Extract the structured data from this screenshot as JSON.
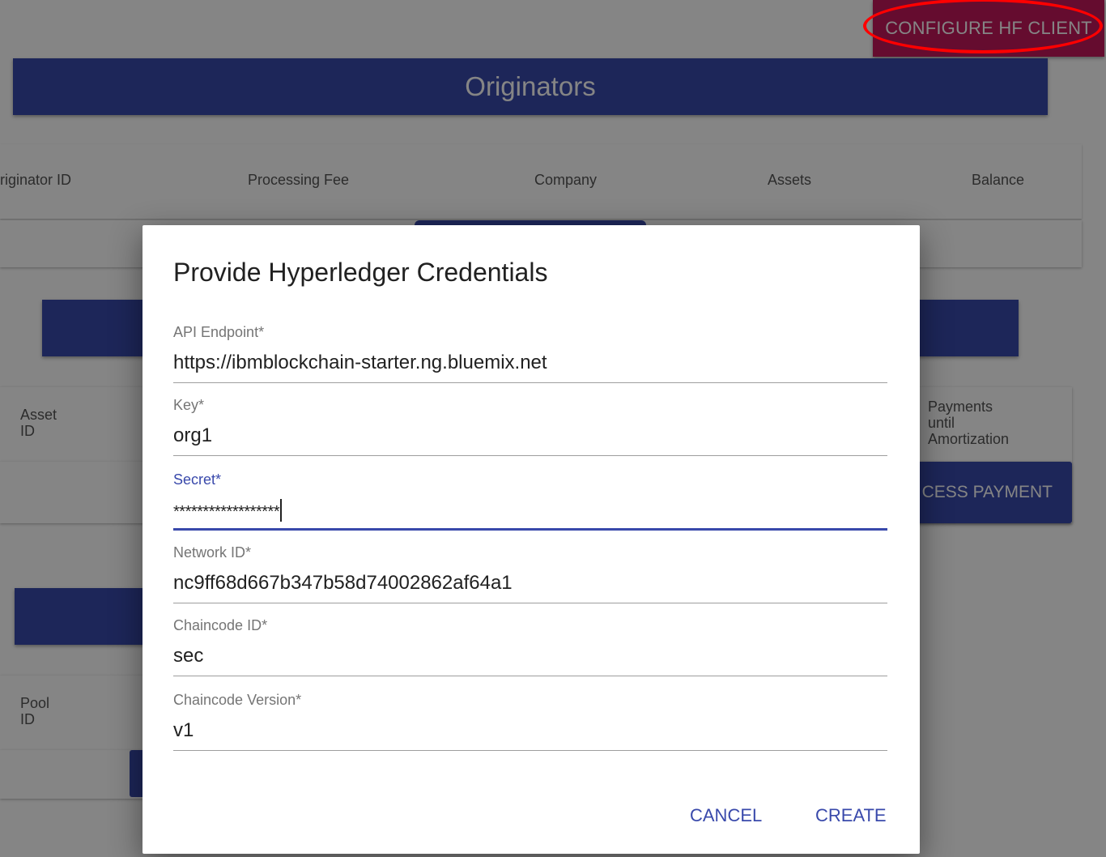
{
  "header": {
    "configure_button": "CONFIGURE HF CLIENT",
    "page_title": "Originators"
  },
  "table": {
    "columns": [
      "riginator ID",
      "Processing Fee",
      "Company",
      "Assets",
      "Balance"
    ]
  },
  "asset_section": {
    "asset_label": "Asset\nID",
    "payments_label": "Payments\nuntil\nAmortization",
    "process_button": "CESS PAYMENT"
  },
  "pool_section": {
    "pool_label": "Pool\nID"
  },
  "dialog": {
    "title": "Provide Hyperledger Credentials",
    "fields": [
      {
        "label": "API Endpoint",
        "required_mark": "*",
        "value": "https://ibmblockchain-starter.ng.bluemix.net"
      },
      {
        "label": "Key",
        "required_mark": "*",
        "value": "org1"
      },
      {
        "label": "Secret",
        "required_mark": "*",
        "value": "******************"
      },
      {
        "label": "Network ID",
        "required_mark": "*",
        "value": "nc9ff68d667b347b58d74002862af64a1"
      },
      {
        "label": "Chaincode ID",
        "required_mark": "*",
        "value": "sec"
      },
      {
        "label": "Chaincode Version",
        "required_mark": "*",
        "value": "v1"
      }
    ],
    "cancel_label": "CANCEL",
    "create_label": "CREATE"
  },
  "colors": {
    "primary": "#3949ab",
    "accent_pink": "#c2185b",
    "annotation_red": "#ff0000"
  }
}
